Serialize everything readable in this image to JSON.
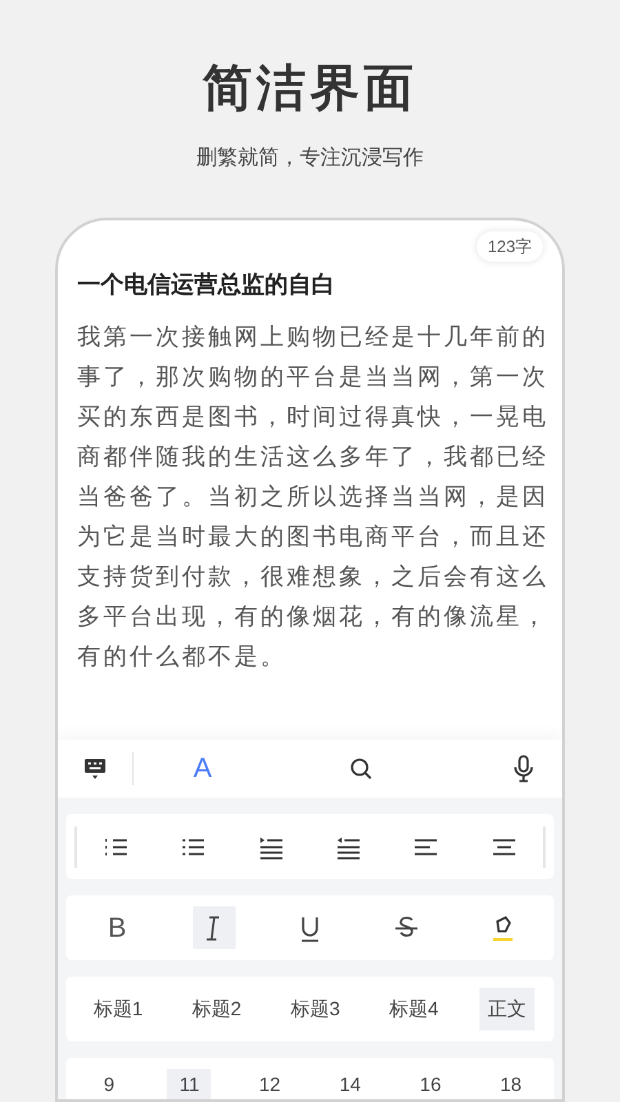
{
  "header": {
    "title": "简洁界面",
    "subtitle": "删繁就简，专注沉浸写作"
  },
  "document": {
    "word_count": "123字",
    "title": "一个电信运营总监的自白",
    "body": "我第一次接触网上购物已经是十几年前的事了，那次购物的平台是当当网，第一次买的东西是图书，时间过得真快，一晃电商都伴随我的生活这么多年了，我都已经当爸爸了。当初之所以选择当当网，是因为它是当时最大的图书电商平台，而且还支持货到付款，很难想象，之后会有这么多平台出现，有的像烟花，有的像流星，有的什么都不是。"
  },
  "toolbar": [
    {
      "kind": "keyboard",
      "selected": false
    },
    {
      "kind": "text",
      "label": "A",
      "selected": true
    },
    {
      "kind": "search",
      "selected": false
    },
    {
      "kind": "mic",
      "selected": false
    }
  ],
  "paragraph_tools": [
    {
      "kind": "ordered"
    },
    {
      "kind": "bullets"
    },
    {
      "kind": "indent"
    },
    {
      "kind": "outdent"
    },
    {
      "kind": "align-left"
    },
    {
      "kind": "align-center"
    }
  ],
  "format_tools": [
    {
      "kind": "bold",
      "label": "B",
      "selected": false
    },
    {
      "kind": "italic",
      "selected": true
    },
    {
      "kind": "underline",
      "selected": false
    },
    {
      "kind": "strike",
      "selected": false
    },
    {
      "kind": "highlight",
      "selected": false
    }
  ],
  "styles": [
    {
      "label": "标题1",
      "selected": false
    },
    {
      "label": "标题2",
      "selected": false
    },
    {
      "label": "标题3",
      "selected": false
    },
    {
      "label": "标题4",
      "selected": false
    },
    {
      "label": "正文",
      "selected": true
    }
  ],
  "sizes": [
    {
      "label": "9",
      "selected": false
    },
    {
      "label": "11",
      "selected": true
    },
    {
      "label": "12",
      "selected": false
    },
    {
      "label": "14",
      "selected": false
    },
    {
      "label": "16",
      "selected": false
    },
    {
      "label": "18",
      "selected": false
    }
  ]
}
